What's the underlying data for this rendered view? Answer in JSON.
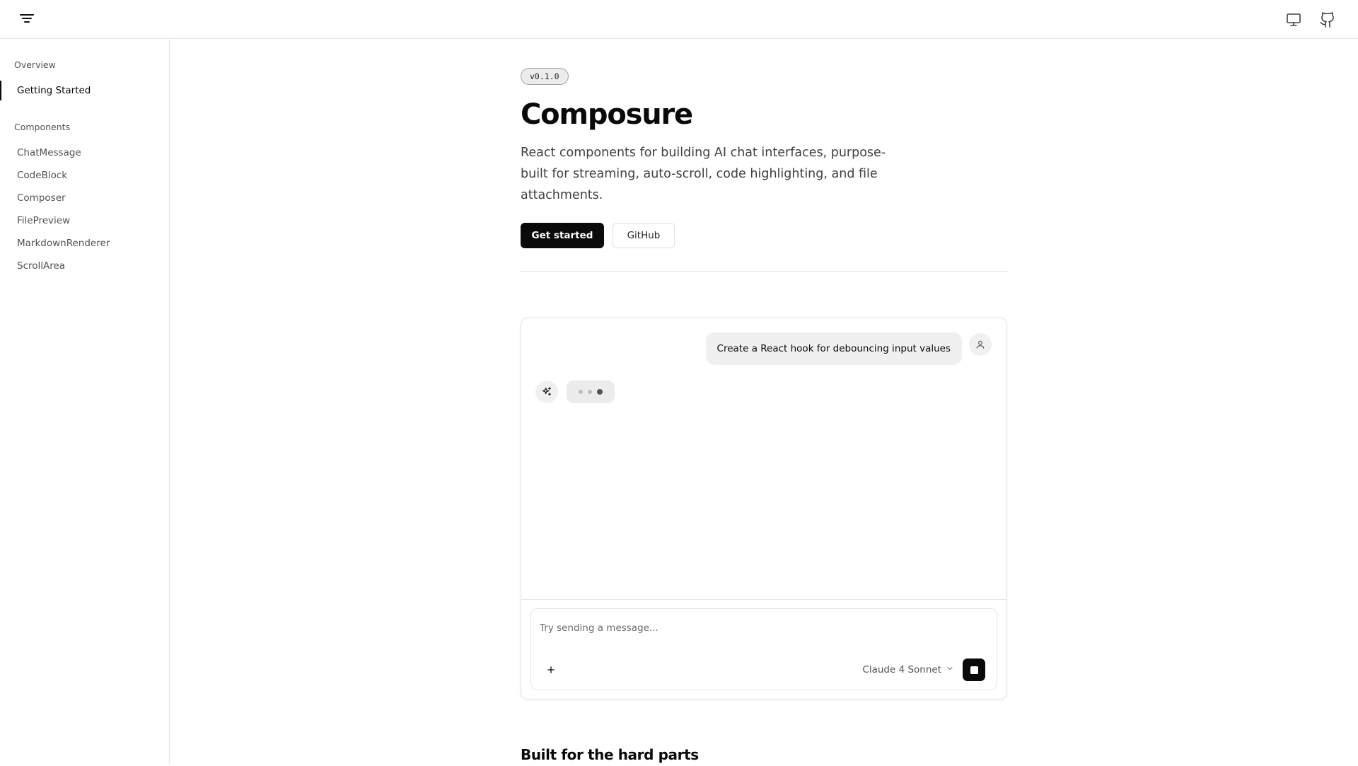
{
  "header": {
    "menu_icon": "filter-lines-icon",
    "right_icons": [
      "monitor-icon",
      "github-icon"
    ]
  },
  "sidebar": {
    "sections": [
      {
        "heading": "Overview",
        "items": [
          {
            "label": "Getting Started",
            "active": true
          }
        ]
      },
      {
        "heading": "Components",
        "items": [
          {
            "label": "ChatMessage"
          },
          {
            "label": "CodeBlock"
          },
          {
            "label": "Composer"
          },
          {
            "label": "FilePreview"
          },
          {
            "label": "MarkdownRenderer"
          },
          {
            "label": "ScrollArea"
          }
        ]
      }
    ]
  },
  "hero": {
    "version": "v0.1.0",
    "title": "Composure",
    "description": "React components for building AI chat interfaces, purpose-built for streaming, auto-scroll, code highlighting, and file attachments.",
    "primary_button": "Get started",
    "secondary_button": "GitHub"
  },
  "demo": {
    "user_message": "Create a React hook for debouncing input values",
    "user_avatar_icon": "user-icon",
    "assistant_avatar_icon": "sparkles-icon",
    "assistant_state": "typing",
    "composer": {
      "placeholder": "Try sending a message...",
      "value": "",
      "attach_icon": "plus-icon",
      "model": "Claude 4 Sonnet",
      "model_dropdown_icon": "chevron-down-icon",
      "send_state_icon": "stop-icon"
    }
  },
  "features": {
    "heading": "Built for the hard parts"
  },
  "colors": {
    "accent": "#0a0a0a",
    "border": "#e5e5e5",
    "muted_bg": "#f0f0f0",
    "muted_text": "#525252"
  }
}
